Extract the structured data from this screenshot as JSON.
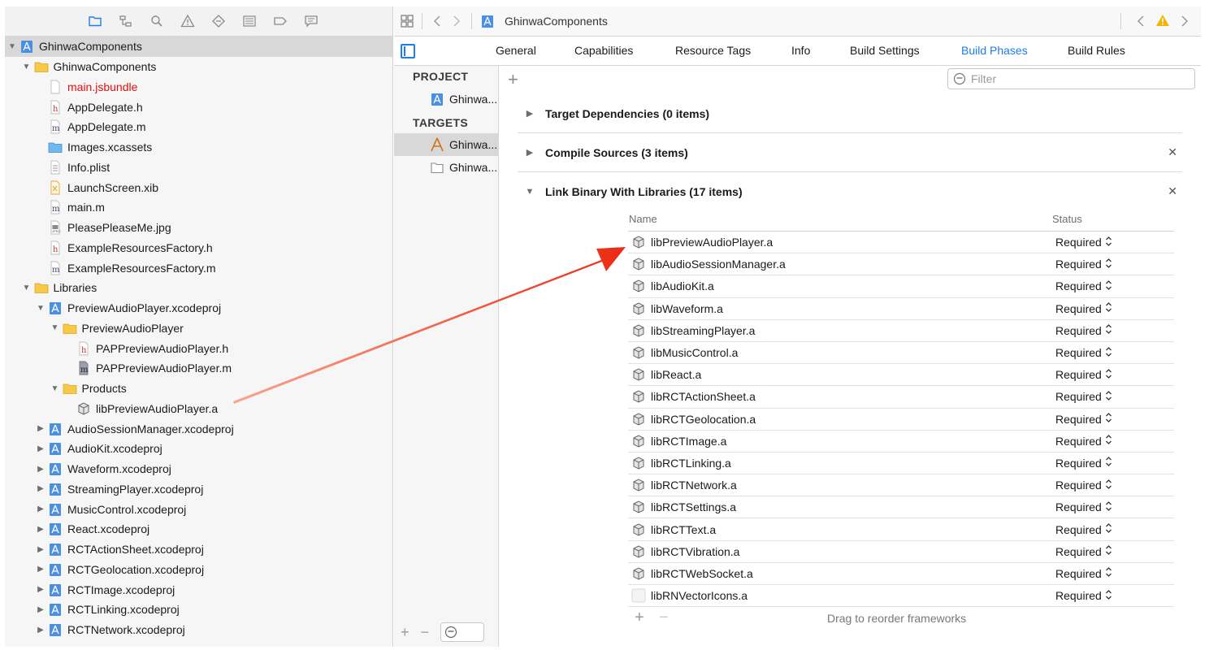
{
  "navigator": {
    "toolbar_icons": [
      "folder-icon",
      "hierarchy-icon",
      "search-icon",
      "warning-icon",
      "test-diamond-icon",
      "debug-list-icon",
      "breakpoint-tag-icon",
      "report-bubble-icon"
    ],
    "tree": [
      {
        "label": "GhinwaComponents",
        "indent": 0,
        "expanded": true,
        "icon": "project",
        "selected": true
      },
      {
        "label": "GhinwaComponents",
        "indent": 1,
        "expanded": true,
        "icon": "folder"
      },
      {
        "label": "main.jsbundle",
        "indent": 2,
        "icon": "blank",
        "red": true
      },
      {
        "label": "AppDelegate.h",
        "indent": 2,
        "icon": "h"
      },
      {
        "label": "AppDelegate.m",
        "indent": 2,
        "icon": "m"
      },
      {
        "label": "Images.xcassets",
        "indent": 2,
        "icon": "xcassets"
      },
      {
        "label": "Info.plist",
        "indent": 2,
        "icon": "plist"
      },
      {
        "label": "LaunchScreen.xib",
        "indent": 2,
        "icon": "xib"
      },
      {
        "label": "main.m",
        "indent": 2,
        "icon": "m"
      },
      {
        "label": "PleasePleaseMe.jpg",
        "indent": 2,
        "icon": "jpg"
      },
      {
        "label": "ExampleResourcesFactory.h",
        "indent": 2,
        "icon": "h"
      },
      {
        "label": "ExampleResourcesFactory.m",
        "indent": 2,
        "icon": "m"
      },
      {
        "label": "Libraries",
        "indent": 1,
        "expanded": true,
        "icon": "folder"
      },
      {
        "label": "PreviewAudioPlayer.xcodeproj",
        "indent": 2,
        "expanded": true,
        "icon": "project"
      },
      {
        "label": "PreviewAudioPlayer",
        "indent": 3,
        "expanded": true,
        "icon": "folder"
      },
      {
        "label": "PAPPreviewAudioPlayer.h",
        "indent": 4,
        "icon": "h"
      },
      {
        "label": "PAPPreviewAudioPlayer.m",
        "indent": 4,
        "icon": "mdark"
      },
      {
        "label": "Products",
        "indent": 3,
        "expanded": true,
        "icon": "folder"
      },
      {
        "label": "libPreviewAudioPlayer.a",
        "indent": 4,
        "icon": "lib"
      },
      {
        "label": "AudioSessionManager.xcodeproj",
        "indent": 2,
        "expanded": false,
        "icon": "project"
      },
      {
        "label": "AudioKit.xcodeproj",
        "indent": 2,
        "expanded": false,
        "icon": "project"
      },
      {
        "label": "Waveform.xcodeproj",
        "indent": 2,
        "expanded": false,
        "icon": "project"
      },
      {
        "label": "StreamingPlayer.xcodeproj",
        "indent": 2,
        "expanded": false,
        "icon": "project"
      },
      {
        "label": "MusicControl.xcodeproj",
        "indent": 2,
        "expanded": false,
        "icon": "project"
      },
      {
        "label": "React.xcodeproj",
        "indent": 2,
        "expanded": false,
        "icon": "project"
      },
      {
        "label": "RCTActionSheet.xcodeproj",
        "indent": 2,
        "expanded": false,
        "icon": "project"
      },
      {
        "label": "RCTGeolocation.xcodeproj",
        "indent": 2,
        "expanded": false,
        "icon": "project"
      },
      {
        "label": "RCTImage.xcodeproj",
        "indent": 2,
        "expanded": false,
        "icon": "project"
      },
      {
        "label": "RCTLinking.xcodeproj",
        "indent": 2,
        "expanded": false,
        "icon": "project"
      },
      {
        "label": "RCTNetwork.xcodeproj",
        "indent": 2,
        "expanded": false,
        "icon": "project"
      }
    ]
  },
  "jump_bar": {
    "path_label": "GhinwaComponents"
  },
  "tabs": {
    "general": "General",
    "capabilities": "Capabilities",
    "resource_tags": "Resource Tags",
    "info": "Info",
    "build_settings": "Build Settings",
    "build_phases": "Build Phases",
    "build_rules": "Build Rules",
    "active": "build_phases"
  },
  "targets_pane": {
    "project_header": "PROJECT",
    "project_item": "Ghinwa...",
    "targets_header": "TARGETS",
    "target_items": [
      "Ghinwa...",
      "Ghinwa..."
    ]
  },
  "filter": {
    "placeholder": "Filter"
  },
  "phases": {
    "target_dependencies": "Target Dependencies (0 items)",
    "compile_sources": "Compile Sources (3 items)",
    "link_binary": "Link Binary With Libraries (17 items)"
  },
  "lib_table": {
    "col_name": "Name",
    "col_status": "Status",
    "rows": [
      {
        "name": "libPreviewAudioPlayer.a",
        "status": "Required"
      },
      {
        "name": "libAudioSessionManager.a",
        "status": "Required"
      },
      {
        "name": "libAudioKit.a",
        "status": "Required"
      },
      {
        "name": "libWaveform.a",
        "status": "Required"
      },
      {
        "name": "libStreamingPlayer.a",
        "status": "Required"
      },
      {
        "name": "libMusicControl.a",
        "status": "Required"
      },
      {
        "name": "libReact.a",
        "status": "Required"
      },
      {
        "name": "libRCTActionSheet.a",
        "status": "Required"
      },
      {
        "name": "libRCTGeolocation.a",
        "status": "Required"
      },
      {
        "name": "libRCTImage.a",
        "status": "Required"
      },
      {
        "name": "libRCTLinking.a",
        "status": "Required"
      },
      {
        "name": "libRCTNetwork.a",
        "status": "Required"
      },
      {
        "name": "libRCTSettings.a",
        "status": "Required"
      },
      {
        "name": "libRCTText.a",
        "status": "Required"
      },
      {
        "name": "libRCTVibration.a",
        "status": "Required"
      },
      {
        "name": "libRCTWebSocket.a",
        "status": "Required"
      },
      {
        "name": "libRNVectorIcons.a",
        "status": "Required",
        "blank_icon": true
      }
    ],
    "footer_hint": "Drag to reorder frameworks"
  },
  "colors": {
    "accent": "#1e7cf2",
    "annotation_arrow": "#f0452a",
    "warning": "#f5b400"
  }
}
